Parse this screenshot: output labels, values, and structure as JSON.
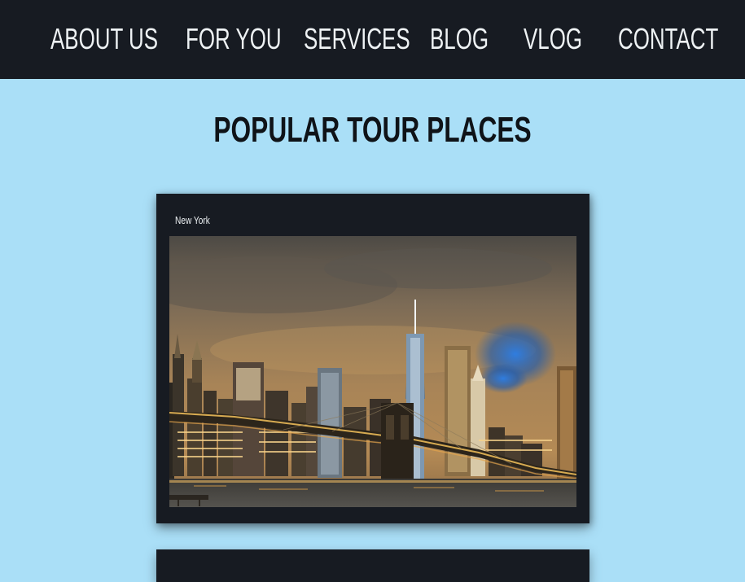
{
  "nav": {
    "items": [
      {
        "label": "ABOUT US"
      },
      {
        "label": "FOR YOU"
      },
      {
        "label": "SERVICES"
      },
      {
        "label": "BLOG"
      },
      {
        "label": "VLOG"
      },
      {
        "label": "CONTACT"
      }
    ]
  },
  "main": {
    "title": "POPULAR TOUR PLACES",
    "cards": [
      {
        "caption": "New York",
        "image": "new-york-skyline-brooklyn-bridge-night"
      }
    ]
  },
  "colors": {
    "background": "#aadff7",
    "nav_bg": "#171b22",
    "card_bg": "#171b22",
    "nav_text": "#eef2f4",
    "title_text": "#0f1318"
  }
}
